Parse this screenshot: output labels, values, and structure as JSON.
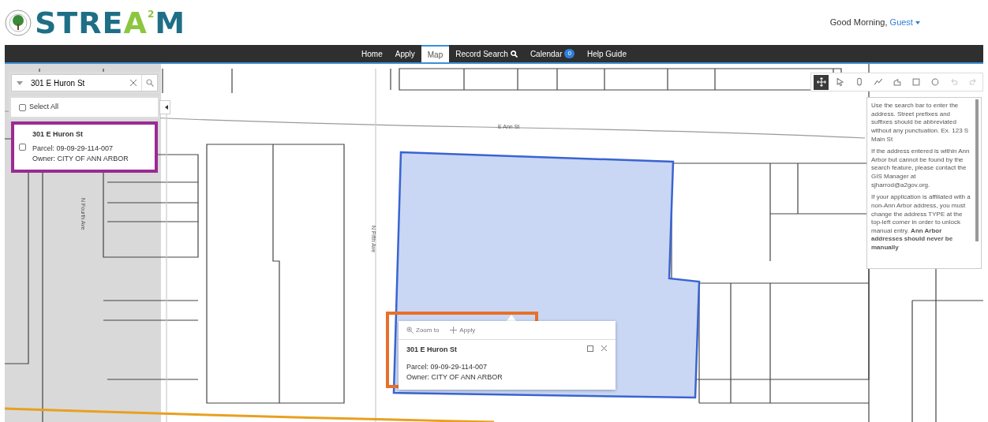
{
  "header": {
    "logo": {
      "prefix": "STRE",
      "accent": "A",
      "sup": "2",
      "suffix": "M"
    },
    "greeting": "Good Morning,",
    "user": "Guest"
  },
  "nav": [
    {
      "label": "Home",
      "kind": "plain",
      "selected": false
    },
    {
      "label": "Apply",
      "kind": "plain",
      "selected": false
    },
    {
      "label": "Map",
      "kind": "plain",
      "selected": true
    },
    {
      "label": "Record Search",
      "kind": "search",
      "selected": false
    },
    {
      "label": "Calendar",
      "kind": "badge",
      "badge": "0",
      "selected": false
    },
    {
      "label": "Help Guide",
      "kind": "plain",
      "selected": false
    }
  ],
  "search": {
    "value": "301 E Huron St"
  },
  "select_all": {
    "label": "Select All",
    "checked": false
  },
  "results": [
    {
      "title": "301 E Huron St",
      "parcel": "Parcel: 09-09-29-114-007",
      "owner": "Owner: CITY OF ANN ARBOR",
      "checked": false,
      "highlighted": true
    }
  ],
  "map": {
    "street_labels": [
      {
        "text": "E Ann St",
        "kind": "horizontal"
      },
      {
        "text": "N Fifth Ave",
        "kind": "vertical"
      },
      {
        "text": "N Fourth Ave",
        "kind": "vertical"
      }
    ]
  },
  "toolbar": [
    {
      "kind": "move",
      "selected": true
    },
    {
      "kind": "pointer",
      "selected": false
    },
    {
      "kind": "pin",
      "selected": false
    },
    {
      "kind": "line",
      "selected": false
    },
    {
      "kind": "polygon",
      "selected": false
    },
    {
      "kind": "square",
      "selected": false
    },
    {
      "kind": "circle",
      "selected": false
    },
    {
      "kind": "undo",
      "selected": false
    },
    {
      "kind": "redo",
      "selected": false
    }
  ],
  "help": {
    "paragraphs": [
      "Use the search bar to enter the address. Street prefixes and suffixes should be abbreviated without any punctuation. Ex. 123 S Main St",
      "If the address entered is within Ann Arbor but cannot be found by the search feature, please contact the GIS Manager at sjharrod@a2gov.org.",
      "If your application is affiliated with a non-Ann Arbor address, you must change the address TYPE at the top-left corner in order to unlock manual entry. **Ann Arbor addresses should never be manually**"
    ]
  },
  "popup": {
    "actions": [
      {
        "label": "Zoom to",
        "kind": "zoom"
      },
      {
        "label": "Apply",
        "kind": "plus"
      }
    ],
    "title": "301 E Huron St",
    "parcel": "Parcel: 09-09-29-114-007",
    "owner": "Owner: CITY OF ANN ARBOR",
    "highlighted": true
  }
}
